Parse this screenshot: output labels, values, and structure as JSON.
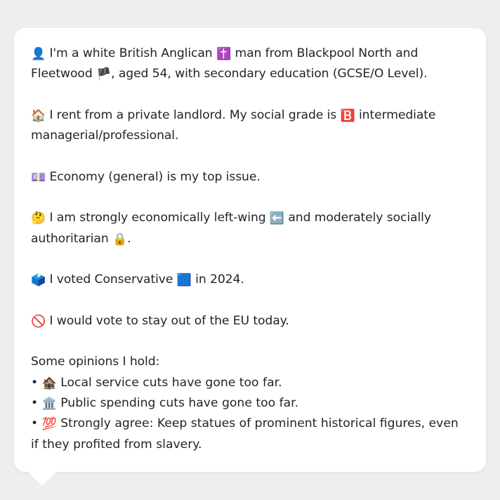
{
  "profile": {
    "p1": {
      "icon": "👤",
      "text_a": "I'm a white British Anglican",
      "icon2": "✝️",
      "text_b": "man from Blackpool North and Fleetwood",
      "icon3": "🏴",
      "text_c": ", aged 54, with secondary education (GCSE/O Level)."
    },
    "p2": {
      "icon": "🏠",
      "text_a": "I rent from a private landlord. My social grade is",
      "icon2": "🅱️",
      "text_b": "intermediate managerial/professional."
    },
    "p3": {
      "icon": "💷",
      "text_a": "Economy (general) is my top issue."
    },
    "p4": {
      "icon": "🤔",
      "text_a": "I am strongly economically left-wing",
      "icon2": "⬅️",
      "text_b": "and moderately socially authoritarian",
      "icon3": "🔒",
      "text_c": "."
    },
    "p5": {
      "icon": "🗳️",
      "text_a": "I voted Conservative",
      "icon2": "🟦",
      "text_b": "in 2024."
    },
    "p6": {
      "icon": "🚫",
      "text_a": "I would vote to stay out of the EU today."
    },
    "opinions_heading": "Some opinions I hold:",
    "opinions": [
      {
        "bullet": "•",
        "icon": "🏚️",
        "text": "Local service cuts have gone too far."
      },
      {
        "bullet": "•",
        "icon": "🏛️",
        "text": "Public spending cuts have gone too far."
      },
      {
        "bullet": "•",
        "icon": "💯",
        "text": "Strongly agree: Keep statues of prominent historical figures, even if they profited from slavery."
      }
    ]
  },
  "colors": {
    "background": "#eceef0",
    "card": "#ffffff",
    "text": "#1f2328"
  }
}
